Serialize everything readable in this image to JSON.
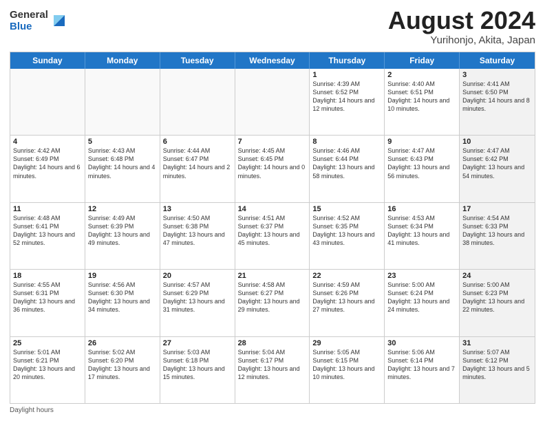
{
  "logo": {
    "general": "General",
    "blue": "Blue"
  },
  "title": {
    "month_year": "August 2024",
    "location": "Yurihonjo, Akita, Japan"
  },
  "headers": [
    "Sunday",
    "Monday",
    "Tuesday",
    "Wednesday",
    "Thursday",
    "Friday",
    "Saturday"
  ],
  "rows": [
    [
      {
        "day": "",
        "text": "",
        "empty": true
      },
      {
        "day": "",
        "text": "",
        "empty": true
      },
      {
        "day": "",
        "text": "",
        "empty": true
      },
      {
        "day": "",
        "text": "",
        "empty": true
      },
      {
        "day": "1",
        "text": "Sunrise: 4:39 AM\nSunset: 6:52 PM\nDaylight: 14 hours and 12 minutes."
      },
      {
        "day": "2",
        "text": "Sunrise: 4:40 AM\nSunset: 6:51 PM\nDaylight: 14 hours and 10 minutes."
      },
      {
        "day": "3",
        "text": "Sunrise: 4:41 AM\nSunset: 6:50 PM\nDaylight: 14 hours and 8 minutes.",
        "shaded": true
      }
    ],
    [
      {
        "day": "4",
        "text": "Sunrise: 4:42 AM\nSunset: 6:49 PM\nDaylight: 14 hours and 6 minutes."
      },
      {
        "day": "5",
        "text": "Sunrise: 4:43 AM\nSunset: 6:48 PM\nDaylight: 14 hours and 4 minutes."
      },
      {
        "day": "6",
        "text": "Sunrise: 4:44 AM\nSunset: 6:47 PM\nDaylight: 14 hours and 2 minutes."
      },
      {
        "day": "7",
        "text": "Sunrise: 4:45 AM\nSunset: 6:45 PM\nDaylight: 14 hours and 0 minutes."
      },
      {
        "day": "8",
        "text": "Sunrise: 4:46 AM\nSunset: 6:44 PM\nDaylight: 13 hours and 58 minutes."
      },
      {
        "day": "9",
        "text": "Sunrise: 4:47 AM\nSunset: 6:43 PM\nDaylight: 13 hours and 56 minutes."
      },
      {
        "day": "10",
        "text": "Sunrise: 4:47 AM\nSunset: 6:42 PM\nDaylight: 13 hours and 54 minutes.",
        "shaded": true
      }
    ],
    [
      {
        "day": "11",
        "text": "Sunrise: 4:48 AM\nSunset: 6:41 PM\nDaylight: 13 hours and 52 minutes."
      },
      {
        "day": "12",
        "text": "Sunrise: 4:49 AM\nSunset: 6:39 PM\nDaylight: 13 hours and 49 minutes."
      },
      {
        "day": "13",
        "text": "Sunrise: 4:50 AM\nSunset: 6:38 PM\nDaylight: 13 hours and 47 minutes."
      },
      {
        "day": "14",
        "text": "Sunrise: 4:51 AM\nSunset: 6:37 PM\nDaylight: 13 hours and 45 minutes."
      },
      {
        "day": "15",
        "text": "Sunrise: 4:52 AM\nSunset: 6:35 PM\nDaylight: 13 hours and 43 minutes."
      },
      {
        "day": "16",
        "text": "Sunrise: 4:53 AM\nSunset: 6:34 PM\nDaylight: 13 hours and 41 minutes."
      },
      {
        "day": "17",
        "text": "Sunrise: 4:54 AM\nSunset: 6:33 PM\nDaylight: 13 hours and 38 minutes.",
        "shaded": true
      }
    ],
    [
      {
        "day": "18",
        "text": "Sunrise: 4:55 AM\nSunset: 6:31 PM\nDaylight: 13 hours and 36 minutes."
      },
      {
        "day": "19",
        "text": "Sunrise: 4:56 AM\nSunset: 6:30 PM\nDaylight: 13 hours and 34 minutes."
      },
      {
        "day": "20",
        "text": "Sunrise: 4:57 AM\nSunset: 6:29 PM\nDaylight: 13 hours and 31 minutes."
      },
      {
        "day": "21",
        "text": "Sunrise: 4:58 AM\nSunset: 6:27 PM\nDaylight: 13 hours and 29 minutes."
      },
      {
        "day": "22",
        "text": "Sunrise: 4:59 AM\nSunset: 6:26 PM\nDaylight: 13 hours and 27 minutes."
      },
      {
        "day": "23",
        "text": "Sunrise: 5:00 AM\nSunset: 6:24 PM\nDaylight: 13 hours and 24 minutes."
      },
      {
        "day": "24",
        "text": "Sunrise: 5:00 AM\nSunset: 6:23 PM\nDaylight: 13 hours and 22 minutes.",
        "shaded": true
      }
    ],
    [
      {
        "day": "25",
        "text": "Sunrise: 5:01 AM\nSunset: 6:21 PM\nDaylight: 13 hours and 20 minutes."
      },
      {
        "day": "26",
        "text": "Sunrise: 5:02 AM\nSunset: 6:20 PM\nDaylight: 13 hours and 17 minutes."
      },
      {
        "day": "27",
        "text": "Sunrise: 5:03 AM\nSunset: 6:18 PM\nDaylight: 13 hours and 15 minutes."
      },
      {
        "day": "28",
        "text": "Sunrise: 5:04 AM\nSunset: 6:17 PM\nDaylight: 13 hours and 12 minutes."
      },
      {
        "day": "29",
        "text": "Sunrise: 5:05 AM\nSunset: 6:15 PM\nDaylight: 13 hours and 10 minutes."
      },
      {
        "day": "30",
        "text": "Sunrise: 5:06 AM\nSunset: 6:14 PM\nDaylight: 13 hours and 7 minutes."
      },
      {
        "day": "31",
        "text": "Sunrise: 5:07 AM\nSunset: 6:12 PM\nDaylight: 13 hours and 5 minutes.",
        "shaded": true
      }
    ]
  ],
  "footer": {
    "note": "Daylight hours"
  }
}
